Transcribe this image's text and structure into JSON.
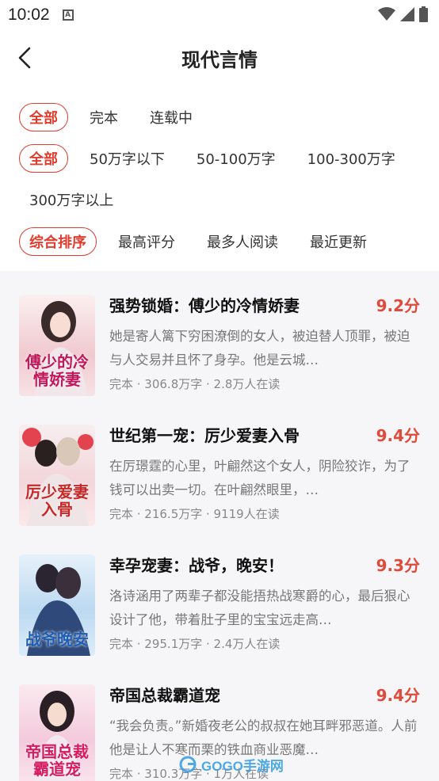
{
  "status_bar": {
    "time": "10:02",
    "notif_glyph": "A"
  },
  "header": {
    "title": "现代言情"
  },
  "filters": {
    "status": [
      "全部",
      "完本",
      "连载中"
    ],
    "words": [
      "全部",
      "50万字以下",
      "50-100万字",
      "100-300万字",
      "300万字以上"
    ],
    "sort": [
      "综合排序",
      "最高评分",
      "最多人阅读",
      "最近更新"
    ]
  },
  "books": [
    {
      "title": "强势锁婚：傅少的冷情娇妻",
      "score": "9.2分",
      "desc": "她是寄人篱下穷困潦倒的女人，被迫替人顶罪，被迫与人交易并且怀了身孕。他是云城…",
      "meta": "完本 · 306.8万字 · 2.8万人在读",
      "cover_text": "傅少的冷情娇妻",
      "cover_color": "#f3d9dc"
    },
    {
      "title": "世纪第一宠：厉少爱妻入骨",
      "score": "9.4分",
      "desc": "在厉璟霆的心里，叶翩然这个女人，阴险狡诈，为了钱可以出卖一切。在叶翩然眼里，…",
      "meta": "完本 · 216.5万字 · 9119人在读",
      "cover_text": "厉少爱妻入骨",
      "cover_color": "#f4e4e6"
    },
    {
      "title": "幸孕宠妻：战爷，晚安！",
      "score": "9.3分",
      "desc": "洛诗涵用了两辈子都没能捂热战寒爵的心，最后狠心设计了他，带着肚子里的宝宝远走高…",
      "meta": "完本 · 295.1万字 · 2.4万人在读",
      "cover_text": "战爷晚安",
      "cover_color": "#cfe3f4"
    },
    {
      "title": "帝国总裁霸道宠",
      "score": "9.4分",
      "desc": "“我会负责。”新婚夜老公的叔叔在她耳畔邪恶道。人前他是让人不寒而栗的铁血商业恶魔…",
      "meta": "完本 · 310.3万字 · 1万人在读",
      "cover_text": "帝国总裁霸道宠",
      "cover_color": "#f5dbe6"
    }
  ],
  "watermark": {
    "text": "GOGO手游网"
  }
}
